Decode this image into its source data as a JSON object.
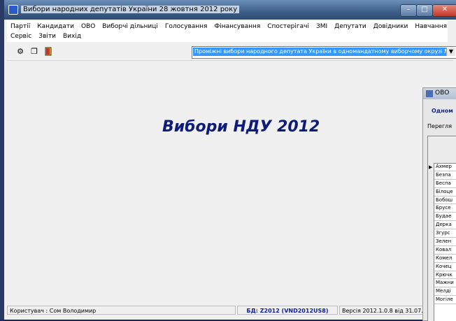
{
  "window": {
    "title": "Вибори народних депутатів України 28 жовтня 2012 року",
    "controls": {
      "minimize": "–",
      "maximize": "□",
      "close": "✕"
    }
  },
  "menu": {
    "row1": [
      "Партії",
      "Кандидати",
      "ОВО",
      "Виборчі дільниці",
      "Голосування",
      "Фінансування",
      "Спостерігачі",
      "ЗМІ",
      "Депутати",
      "Довідники",
      "Навчання"
    ],
    "row2": [
      "Сервіс",
      "Звіти",
      "Вихід"
    ]
  },
  "toolbar": {
    "icons": [
      "connect-icon",
      "copy-documents-icon",
      "exit-door-icon"
    ],
    "election_select": "Проміжні вибори народного депутата України в одномандатному виборчому окрузі №"
  },
  "main": {
    "heading": "Вибори НДУ 2012"
  },
  "child_window": {
    "title": "ОВО",
    "label": "Одном",
    "sub": "Перегля",
    "rows": [
      "Ахмер",
      "Безпа",
      "Беспа",
      "Білоце",
      "Бобош",
      "Брусе",
      "Будае",
      "Дерка",
      "Згурс",
      "Зелен",
      "Ковал",
      "Комел",
      "Кочец",
      "Крючк",
      "Мажни",
      "Мелді",
      "Могіле"
    ]
  },
  "status": {
    "user": "Користувач : Сом Володимир",
    "db": "БД: Z2012 (VND2012US8)",
    "version": "Версія 2012.1.0.8 від 31.07.20"
  }
}
